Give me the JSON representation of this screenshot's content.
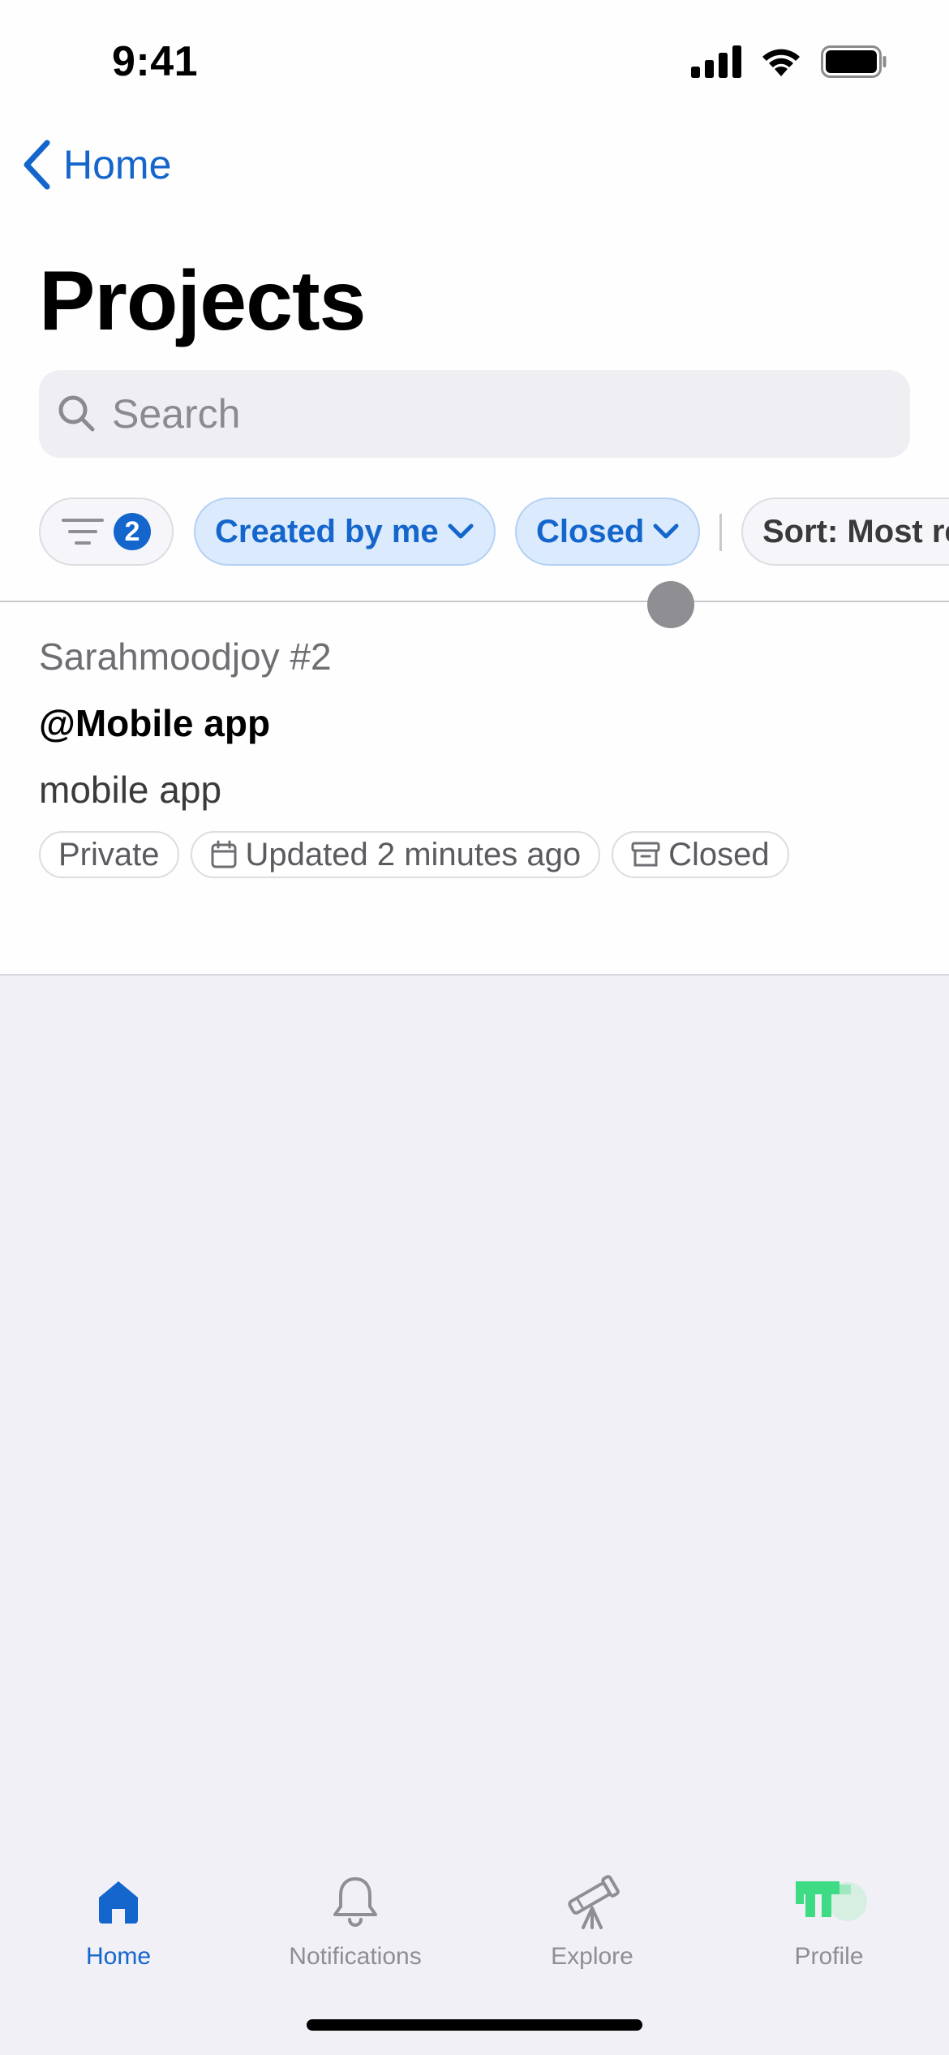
{
  "status_bar": {
    "time": "9:41"
  },
  "nav": {
    "back_label": "Home"
  },
  "page": {
    "title": "Projects"
  },
  "search": {
    "placeholder": "Search"
  },
  "filters": {
    "active_count": "2",
    "created_by": "Created by me",
    "state": "Closed",
    "sort": "Sort: Most re"
  },
  "projects": [
    {
      "owner": "Sarahmoodjoy #2",
      "title": "@Mobile app",
      "description": "mobile app",
      "visibility": "Private",
      "updated": "Updated 2 minutes ago",
      "status": "Closed"
    }
  ],
  "tab_bar": {
    "tabs": [
      {
        "label": "Home",
        "icon": "home-icon",
        "active": true
      },
      {
        "label": "Notifications",
        "icon": "bell-icon",
        "active": false
      },
      {
        "label": "Explore",
        "icon": "telescope-icon",
        "active": false
      },
      {
        "label": "Profile",
        "icon": "avatar-icon",
        "active": false
      }
    ]
  },
  "colors": {
    "accent": "#1466cc",
    "chip_bg": "#dbeafc",
    "background": "#f0f0f6"
  }
}
